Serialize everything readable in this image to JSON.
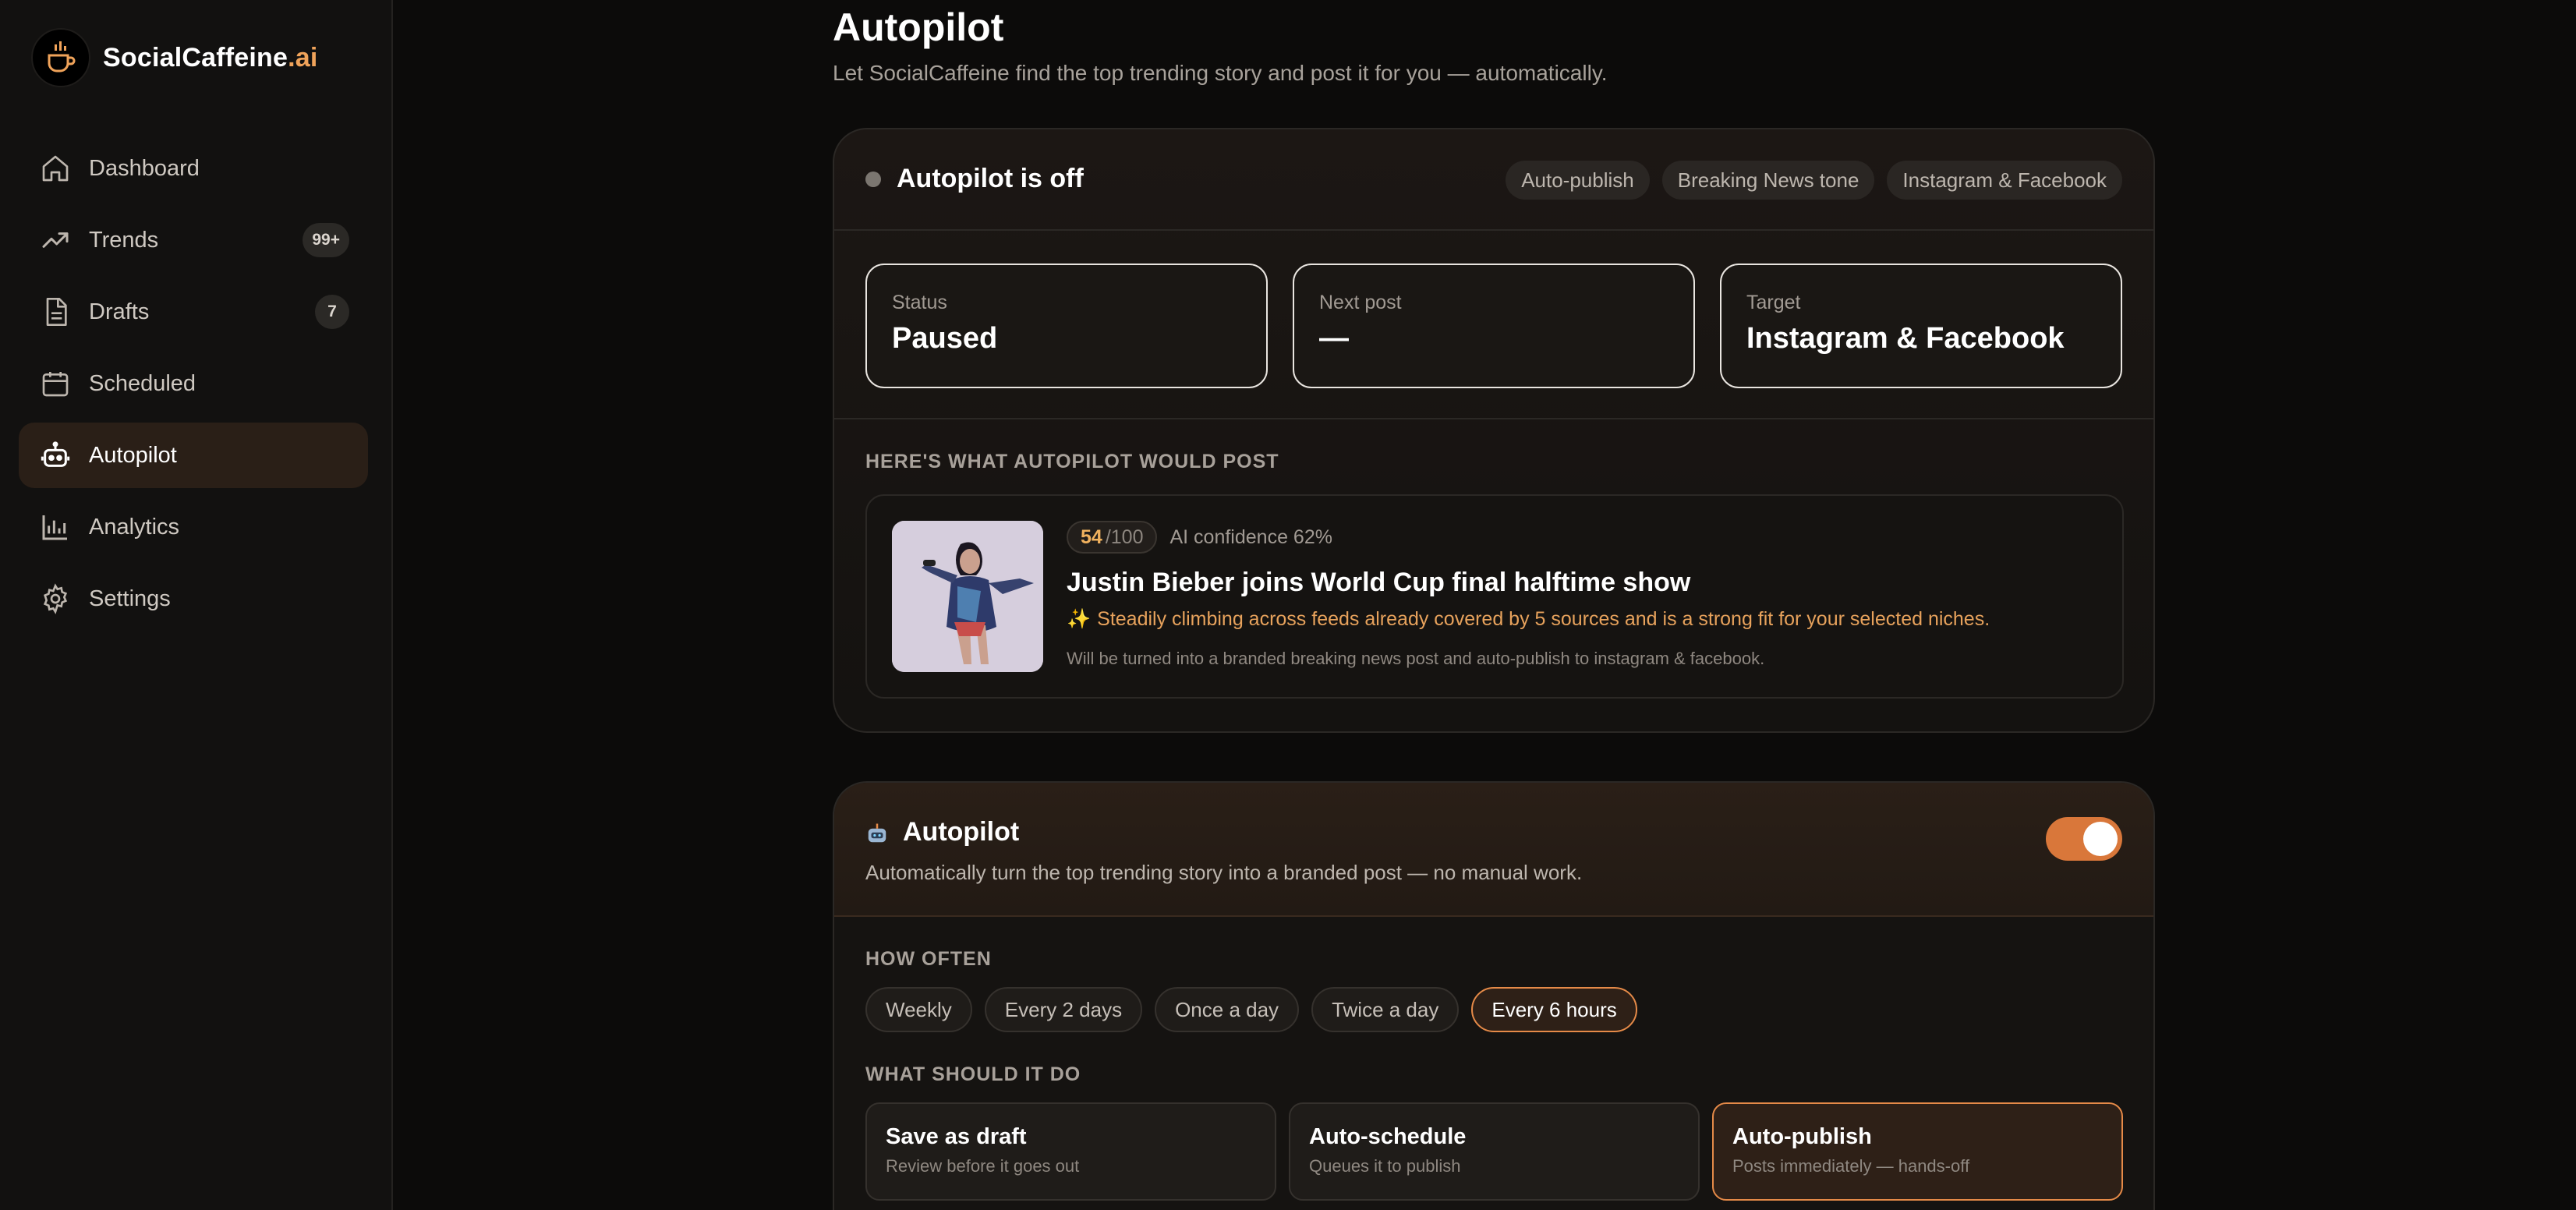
{
  "brand": {
    "name": "SocialCaffeine",
    "accent": ".ai"
  },
  "nav": [
    {
      "label": "Dashboard",
      "icon": "home-icon",
      "badge": ""
    },
    {
      "label": "Trends",
      "icon": "trend-icon",
      "badge": "99+"
    },
    {
      "label": "Drafts",
      "icon": "document-icon",
      "badge": "7"
    },
    {
      "label": "Scheduled",
      "icon": "calendar-icon",
      "badge": ""
    },
    {
      "label": "Autopilot",
      "icon": "robot-icon",
      "badge": "",
      "active": true
    },
    {
      "label": "Analytics",
      "icon": "bar-chart-icon",
      "badge": ""
    },
    {
      "label": "Settings",
      "icon": "gear-icon",
      "badge": ""
    }
  ],
  "header": {
    "title": "Autopilot",
    "subtitle": "Let SocialCaffeine find the top trending story and post it for you — automatically."
  },
  "status_card": {
    "title": "Autopilot is off",
    "tags": [
      "Auto-publish",
      "Breaking News tone",
      "Instagram & Facebook"
    ],
    "stats": [
      {
        "label": "Status",
        "value": "Paused"
      },
      {
        "label": "Next post",
        "value": "—"
      },
      {
        "label": "Target",
        "value": "Instagram & Facebook"
      }
    ],
    "preview_caption": "HERE'S WHAT AUTOPILOT WOULD POST",
    "preview": {
      "score": "54",
      "score_max": "/100",
      "confidence": "AI confidence 62%",
      "headline": "Justin Bieber joins World Cup final halftime show",
      "reason_icon": "✨",
      "reason": "Steadily climbing across feeds already covered by 5 sources and is a strong fit for your selected niches.",
      "note": "Will be turned into a branded breaking news post and auto-publish to instagram & facebook."
    }
  },
  "settings_card": {
    "title": "Autopilot",
    "subtitle": "Automatically turn the top trending story into a branded post — no manual work.",
    "toggle_on": true,
    "how_often_caption": "HOW OFTEN",
    "frequencies": [
      "Weekly",
      "Every 2 days",
      "Once a day",
      "Twice a day",
      "Every 6 hours"
    ],
    "selected_frequency": "Every 6 hours",
    "what_caption": "WHAT SHOULD IT DO",
    "actions": [
      {
        "title": "Save as draft",
        "sub": "Review before it goes out"
      },
      {
        "title": "Auto-schedule",
        "sub": "Queues it to publish"
      },
      {
        "title": "Auto-publish",
        "sub": "Posts immediately — hands-off"
      }
    ],
    "selected_action": "Auto-publish"
  },
  "colors": {
    "accent": "#e58a48",
    "brand_accent": "#f0a35a",
    "background": "#0c0b0a"
  }
}
